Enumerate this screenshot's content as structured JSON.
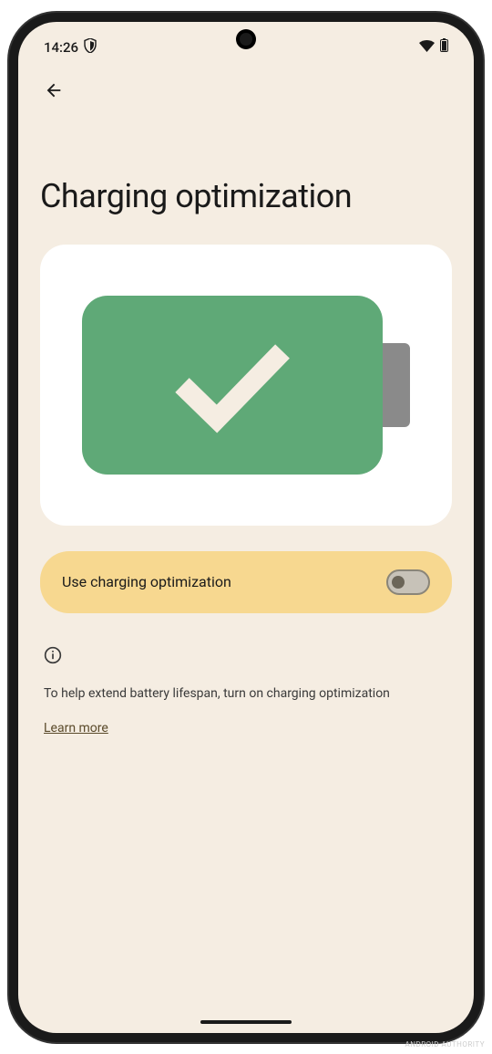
{
  "statusBar": {
    "time": "14:26"
  },
  "page": {
    "title": "Charging optimization"
  },
  "toggle": {
    "label": "Use charging optimization",
    "enabled": false
  },
  "info": {
    "text": "To help extend battery lifespan, turn on charging optimization",
    "learnMore": "Learn more"
  },
  "watermark": "ANDROID AUTHORITY"
}
